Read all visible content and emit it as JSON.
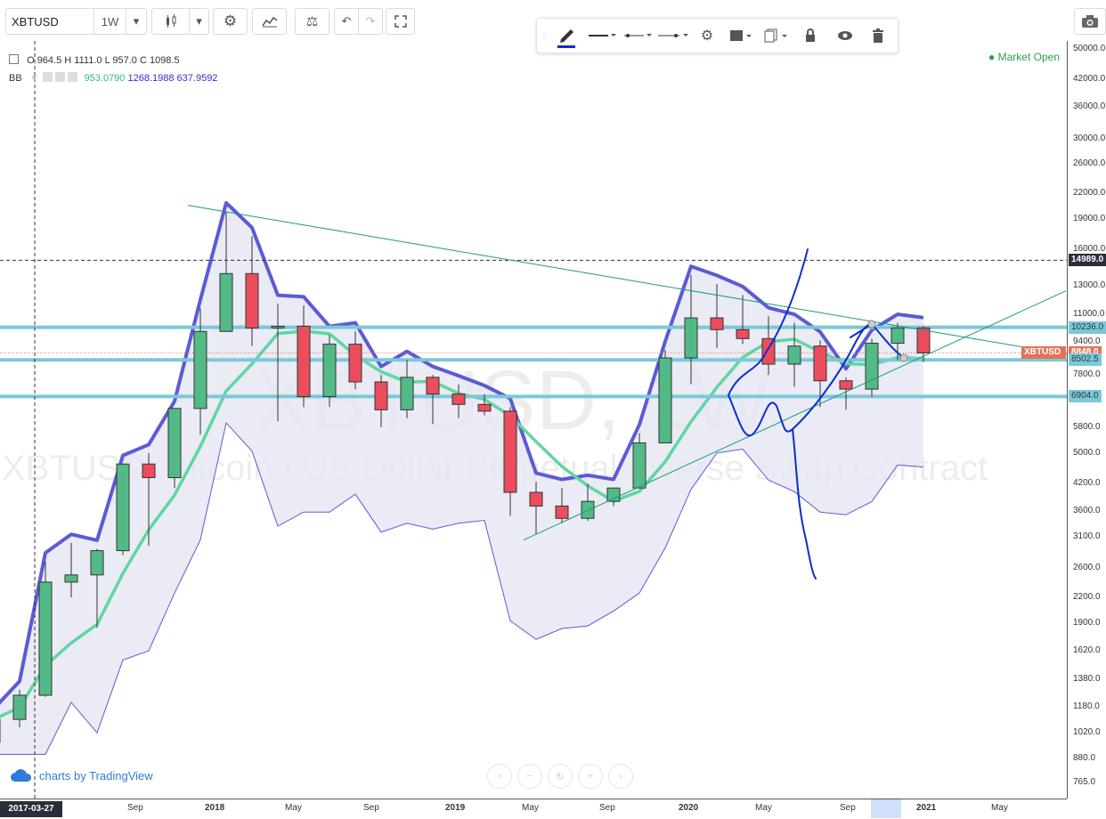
{
  "toolbar": {
    "symbol": "XBTUSD",
    "interval": "1W"
  },
  "legend": {
    "ohlc_label_o": "O",
    "ohlc_o": "964.5",
    "ohlc_label_h": "H",
    "ohlc_h": "1111.0",
    "ohlc_label_c": "C",
    "ohlc_c": "1098.5",
    "ohlc_label_l": "L",
    "ohlc_l": "957.0",
    "bb_label": "BB",
    "bb_basis": "953.0790",
    "bb_upper": "1268.1988",
    "bb_lower": "637.9592"
  },
  "status": {
    "market": "Market Open"
  },
  "watermark": {
    "big": "XBTUSD, 1W",
    "description": "XBTUSD: Bitcoin / US Dollar Perpetual Inverse Swap Contract"
  },
  "branding": {
    "label": "charts by TradingView"
  },
  "colors": {
    "up": "#53b987",
    "down": "#eb4d5c",
    "bb_upper": "#5b5bd6",
    "bb_basis": "#5fd6a1",
    "bb_fill": "#e5e6f1",
    "hline": "#7dc7d8",
    "trend": "#1a9b7c",
    "hand": "#0b2ec9",
    "price_badge": "#e2735a"
  },
  "chart_data": {
    "type": "candlestick",
    "title": "XBTUSD, 1W",
    "y_scale": "log",
    "ylim": [
      740,
      52000
    ],
    "price_ticks": [
      "50000.0",
      "42000.0",
      "36000.0",
      "30000.0",
      "26000.0",
      "22000.0",
      "19000.0",
      "16000.0",
      "13000.0",
      "11000.0",
      "9400.0",
      "7800.0",
      "6900.0",
      "5800.0",
      "5000.0",
      "4200.0",
      "3600.0",
      "3100.0",
      "2600.0",
      "2200.0",
      "1900.0",
      "1620.0",
      "1380.0",
      "1180.0",
      "1020.0",
      "880.0",
      "765.0"
    ],
    "price_labels": [
      {
        "text": "14989.0",
        "value": 14989,
        "kind": "dark"
      },
      {
        "text": "10236.0",
        "value": 10236,
        "kind": "line"
      },
      {
        "text": "XBTUSD",
        "value": 8848,
        "kind": "symbol"
      },
      {
        "text": "8848.0",
        "value": 8848,
        "kind": "price"
      },
      {
        "text": "8502.5",
        "value": 8502.5,
        "kind": "line"
      },
      {
        "text": "6904.0",
        "value": 6904,
        "kind": "line"
      }
    ],
    "time_ticks": [
      "Sep",
      "2018",
      "May",
      "Sep",
      "2019",
      "May",
      "Sep",
      "2020",
      "May",
      "Sep",
      "2021",
      "May"
    ],
    "time_cursor": "2017-03-27",
    "horizontal_lines": [
      10236,
      8502.5,
      6904
    ],
    "dashed_line": 14989,
    "close_price": 8848,
    "trendlines": [
      {
        "from": [
          "2017-11",
          20500
        ],
        "to": [
          "2020-10",
          8560
        ]
      },
      {
        "from": [
          "2018-12",
          3050
        ],
        "to": [
          "2020-09",
          12600
        ]
      }
    ],
    "candles": [
      {
        "t": "2017-03",
        "o": 964.5,
        "h": 1111,
        "l": 957,
        "c": 1098.5
      },
      {
        "t": "2017-04",
        "o": 1098,
        "h": 1300,
        "l": 1050,
        "c": 1260
      },
      {
        "t": "2017-05",
        "o": 1260,
        "h": 2700,
        "l": 1250,
        "c": 2400
      },
      {
        "t": "2017-06",
        "o": 2400,
        "h": 3000,
        "l": 2200,
        "c": 2500
      },
      {
        "t": "2017-07",
        "o": 2500,
        "h": 2900,
        "l": 1850,
        "c": 2870
      },
      {
        "t": "2017-08",
        "o": 2870,
        "h": 4700,
        "l": 2800,
        "c": 4700
      },
      {
        "t": "2017-09",
        "o": 4700,
        "h": 5000,
        "l": 2950,
        "c": 4350
      },
      {
        "t": "2017-10",
        "o": 4350,
        "h": 6400,
        "l": 4100,
        "c": 6450
      },
      {
        "t": "2017-11",
        "o": 6450,
        "h": 11400,
        "l": 5550,
        "c": 10000
      },
      {
        "t": "2017-12",
        "o": 10000,
        "h": 19800,
        "l": 10800,
        "c": 13900
      },
      {
        "t": "2018-01",
        "o": 13900,
        "h": 17200,
        "l": 9200,
        "c": 10200
      },
      {
        "t": "2018-02",
        "o": 10200,
        "h": 11700,
        "l": 6000,
        "c": 10300
      },
      {
        "t": "2018-03",
        "o": 10300,
        "h": 11600,
        "l": 6500,
        "c": 6900
      },
      {
        "t": "2018-04",
        "o": 6900,
        "h": 9800,
        "l": 6500,
        "c": 9300
      },
      {
        "t": "2018-05",
        "o": 9300,
        "h": 10000,
        "l": 7200,
        "c": 7500
      },
      {
        "t": "2018-06",
        "o": 7500,
        "h": 7800,
        "l": 5800,
        "c": 6400
      },
      {
        "t": "2018-07",
        "o": 6400,
        "h": 8500,
        "l": 6100,
        "c": 7700
      },
      {
        "t": "2018-08",
        "o": 7700,
        "h": 7800,
        "l": 5900,
        "c": 7000
      },
      {
        "t": "2018-09",
        "o": 7000,
        "h": 7400,
        "l": 6100,
        "c": 6600
      },
      {
        "t": "2018-10",
        "o": 6600,
        "h": 7000,
        "l": 6200,
        "c": 6350
      },
      {
        "t": "2018-11",
        "o": 6350,
        "h": 6500,
        "l": 3500,
        "c": 4000
      },
      {
        "t": "2018-12",
        "o": 4000,
        "h": 4250,
        "l": 3150,
        "c": 3700
      },
      {
        "t": "2019-01",
        "o": 3700,
        "h": 4100,
        "l": 3350,
        "c": 3450
      },
      {
        "t": "2019-02",
        "o": 3450,
        "h": 4200,
        "l": 3400,
        "c": 3800
      },
      {
        "t": "2019-03",
        "o": 3800,
        "h": 4100,
        "l": 3700,
        "c": 4100
      },
      {
        "t": "2019-04",
        "o": 4100,
        "h": 5600,
        "l": 4100,
        "c": 5300
      },
      {
        "t": "2019-05",
        "o": 5300,
        "h": 9000,
        "l": 5300,
        "c": 8600
      },
      {
        "t": "2019-06",
        "o": 8600,
        "h": 13800,
        "l": 7400,
        "c": 10800
      },
      {
        "t": "2019-07",
        "o": 10800,
        "h": 13100,
        "l": 9100,
        "c": 10100
      },
      {
        "t": "2019-08",
        "o": 10100,
        "h": 12300,
        "l": 9300,
        "c": 9600
      },
      {
        "t": "2019-09",
        "o": 9600,
        "h": 10900,
        "l": 7800,
        "c": 8300
      },
      {
        "t": "2019-10",
        "o": 8300,
        "h": 10500,
        "l": 7300,
        "c": 9200
      },
      {
        "t": "2019-11",
        "o": 9200,
        "h": 9500,
        "l": 6500,
        "c": 7550
      },
      {
        "t": "2019-12",
        "o": 7550,
        "h": 7700,
        "l": 6400,
        "c": 7200
      },
      {
        "t": "2020-01",
        "o": 7200,
        "h": 9600,
        "l": 6900,
        "c": 9350
      },
      {
        "t": "2020-02",
        "o": 9350,
        "h": 10500,
        "l": 8500,
        "c": 10200
      },
      {
        "t": "2020-03",
        "o": 10200,
        "h": 10300,
        "l": 8400,
        "c": 8848
      }
    ]
  }
}
